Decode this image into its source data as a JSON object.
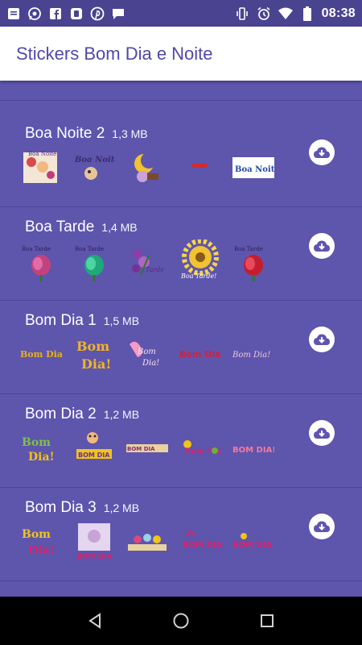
{
  "status_bar": {
    "time": "08:38",
    "left_icons": [
      "message-icon",
      "whatsapp-icon",
      "facebook-icon",
      "app-icon",
      "pinterest-icon",
      "chat-icon"
    ],
    "right_icons": [
      "vibrate-icon",
      "alarm-icon",
      "wifi-icon",
      "battery-icon"
    ]
  },
  "app_bar": {
    "title": "Stickers Bom Dia e Noite"
  },
  "packs": [
    {
      "name": "",
      "size": ""
    },
    {
      "name": "Boa Noite 2",
      "size": "1,3 MB"
    },
    {
      "name": "Boa Tarde",
      "size": "1,4 MB"
    },
    {
      "name": "Bom Dia 1",
      "size": "1,5 MB"
    },
    {
      "name": "Bom Dia 2",
      "size": "1,2 MB"
    },
    {
      "name": "Bom Dia 3",
      "size": "1,2 MB"
    },
    {
      "name": "",
      "size": ""
    }
  ],
  "colors": {
    "background": "#5e55ad",
    "status_bar": "#4a4390",
    "app_bar_title": "#5148a6",
    "navbar": "#000000"
  }
}
